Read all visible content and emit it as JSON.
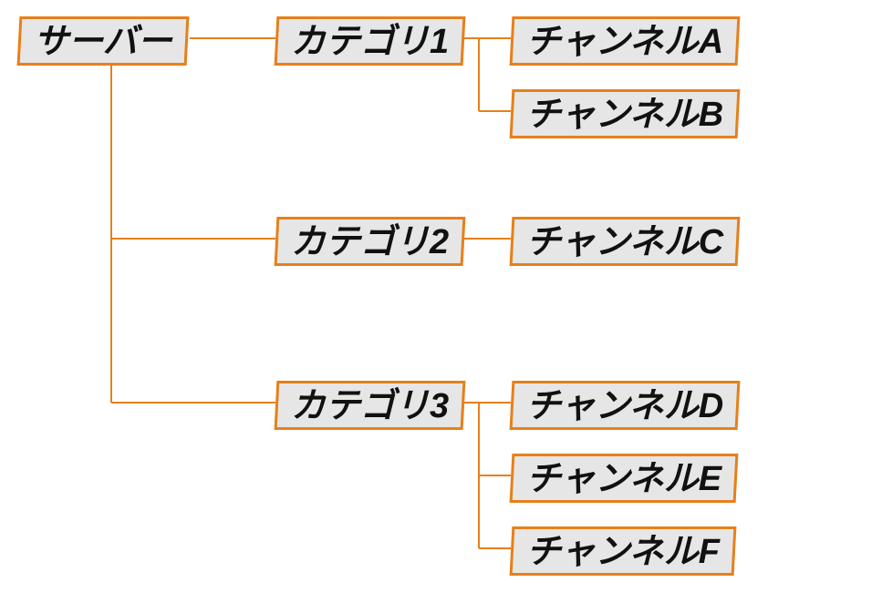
{
  "diagram": {
    "root": {
      "label": "サーバー"
    },
    "categories": [
      {
        "label": "カテゴリ1",
        "channels": [
          {
            "label": "チャンネルA"
          },
          {
            "label": "チャンネルB"
          }
        ]
      },
      {
        "label": "カテゴリ2",
        "channels": [
          {
            "label": "チャンネルC"
          }
        ]
      },
      {
        "label": "カテゴリ3",
        "channels": [
          {
            "label": "チャンネルD"
          },
          {
            "label": "チャンネルE"
          },
          {
            "label": "チャンネルF"
          }
        ]
      }
    ]
  },
  "colors": {
    "border": "#e6801a",
    "node_fill": "#e6e6e6",
    "text": "#111111",
    "connector": "#e6801a"
  }
}
